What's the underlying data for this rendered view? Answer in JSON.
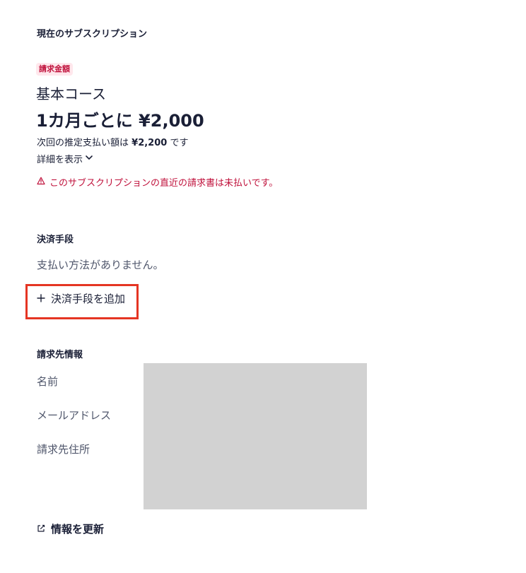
{
  "subscription": {
    "heading": "現在のサブスクリプション",
    "badge": "請求金額",
    "plan_name": "基本コース",
    "plan_price": "1カ月ごとに ¥2,000",
    "next_payment_prefix": "次回の推定支払い額は",
    "next_payment_amount": "¥2,200",
    "next_payment_suffix": "です",
    "details_label": "詳細を表示",
    "warning_text": "このサブスクリプションの直近の請求書は未払いです。",
    "warning_color": "#c0123c"
  },
  "payment": {
    "heading": "決済手段",
    "empty_text": "支払い方法がありません。",
    "add_label": "決済手段を追加",
    "highlight_color": "#e53523"
  },
  "billing": {
    "heading": "請求先情報",
    "labels": [
      "名前",
      "メールアドレス",
      "請求先住所"
    ],
    "update_label": "情報を更新"
  }
}
